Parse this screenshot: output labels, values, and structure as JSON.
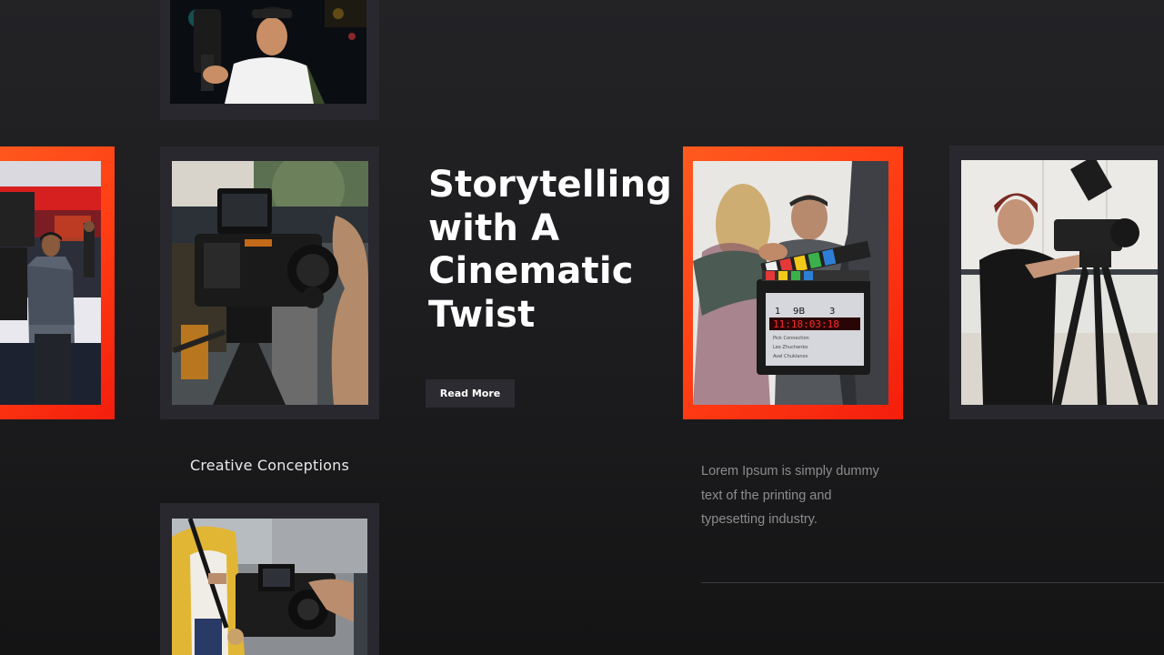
{
  "hero": {
    "title_lines": [
      "Storytelling",
      "with A",
      "Cinematic",
      "Twist"
    ],
    "button_label": "Read More"
  },
  "gallery": {
    "caption": "Creative Conceptions",
    "photos": [
      "videographer-with-gimbal",
      "tv-studio-camera-operator",
      "cinema-camera-on-tripod",
      "film-clapperboard",
      "cameraman-with-tripod-camera",
      "hands-adjusting-camera-rig"
    ],
    "clapper_text": {
      "header": [
        "1",
        "9B",
        "3"
      ],
      "timecode": "11:18:03:18",
      "rows": [
        "Pick Connection",
        "Leo Zhuchenko",
        "Avel Chuklanov"
      ]
    }
  },
  "description": {
    "lines": [
      "Lorem Ipsum is simply dummy",
      "text of the printing and",
      "typesetting industry."
    ]
  },
  "colors": {
    "background": "#1c1c1e",
    "accent": "#ff3d14",
    "frame": "#28282e",
    "button": "#2b2b31",
    "muted_text": "#8c8c90"
  }
}
